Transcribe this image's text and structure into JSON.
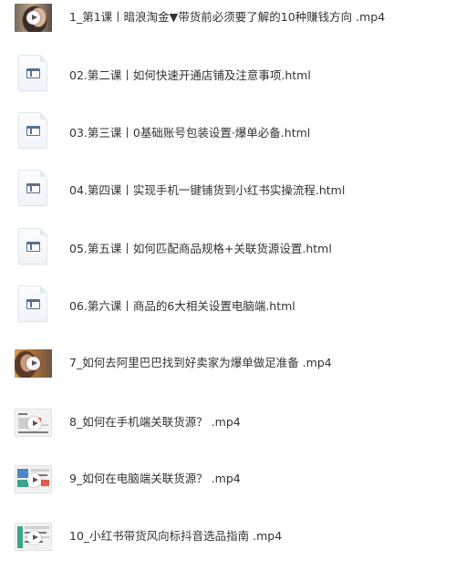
{
  "files": [
    {
      "name": "1_第1课丨暗浪淘金▼带货前必须要了解的10种赚钱方向 .mp4",
      "type": "video",
      "icon": "video-thumbnail-icon"
    },
    {
      "name": "02.第二课丨如何快速开通店铺及注意事项.html",
      "type": "html",
      "icon": "html-file-icon"
    },
    {
      "name": "03.第三课丨0基础账号包装设置·爆单必备.html",
      "type": "html",
      "icon": "html-file-icon"
    },
    {
      "name": "04.第四课丨实现手机一键铺货到小红书实操流程.html",
      "type": "html",
      "icon": "html-file-icon"
    },
    {
      "name": "05.第五课丨如何匹配商品规格+关联货源设置.html",
      "type": "html",
      "icon": "html-file-icon"
    },
    {
      "name": "06.第六课丨商品的6大相关设置电脑端.html",
      "type": "html",
      "icon": "html-file-icon"
    },
    {
      "name": "7_如何去阿里巴巴找到好卖家为爆单做足准备 .mp4",
      "type": "video",
      "icon": "video-thumbnail-icon"
    },
    {
      "name": "8_如何在手机端关联货源？ .mp4",
      "type": "video",
      "icon": "video-thumbnail-icon"
    },
    {
      "name": "9_如何在电脑端关联货源？  .mp4",
      "type": "video",
      "icon": "video-thumbnail-icon"
    },
    {
      "name": "10_小红书带货风向标抖音选品指南 .mp4",
      "type": "video",
      "icon": "video-thumbnail-icon"
    }
  ]
}
